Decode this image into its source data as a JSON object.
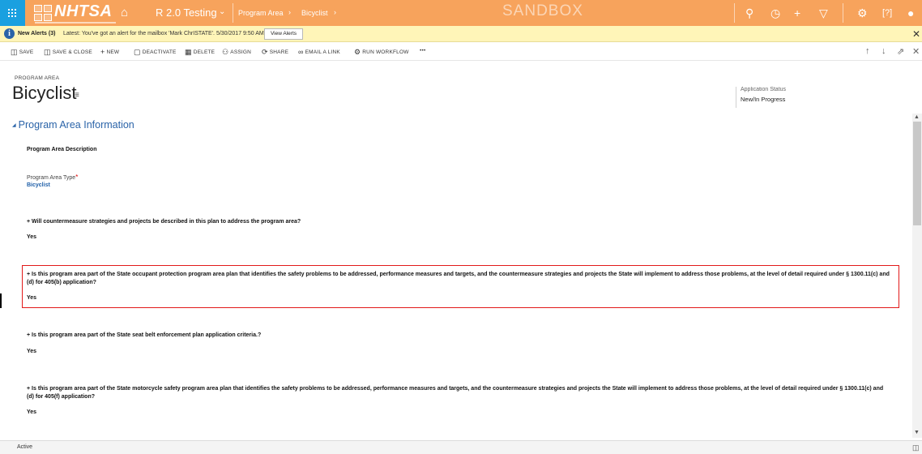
{
  "topbar": {
    "logo_text": "NHTSA",
    "app_name": "R 2.0 Testing",
    "breadcrumb": [
      "Program Area",
      "Bicyclist"
    ],
    "environment": "SANDBOX",
    "icons": [
      "waffle-icon",
      "home-icon",
      "search-icon",
      "history-icon",
      "add-icon",
      "filter-icon",
      "settings-icon",
      "help-icon",
      "user-icon"
    ]
  },
  "alert": {
    "title": "New Alerts (3)",
    "message": "Latest: You've got an alert for the mailbox 'Mark ChrISTATE'. 5/30/2017 9:50 AM",
    "button": "View Alerts"
  },
  "commands": [
    {
      "label": "SAVE",
      "icon": "save-icon"
    },
    {
      "label": "SAVE & CLOSE",
      "icon": "save-close-icon"
    },
    {
      "label": "NEW",
      "icon": "plus-icon"
    },
    {
      "label": "DEACTIVATE",
      "icon": "deactivate-icon"
    },
    {
      "label": "DELETE",
      "icon": "trash-icon"
    },
    {
      "label": "ASSIGN",
      "icon": "assign-icon"
    },
    {
      "label": "SHARE",
      "icon": "share-icon"
    },
    {
      "label": "EMAIL A LINK",
      "icon": "link-icon"
    },
    {
      "label": "RUN WORKFLOW",
      "icon": "workflow-icon"
    },
    {
      "label": "•••",
      "icon": "more-icon"
    }
  ],
  "record": {
    "entity_type": "PROGRAM AREA",
    "name": "Bicyclist",
    "status_label": "Application Status",
    "status_value": "New/In Progress"
  },
  "section": {
    "title": "Program Area Information",
    "fields": [
      {
        "label": "Program Area Description",
        "value": ""
      },
      {
        "label": "Program Area Type",
        "required": "*",
        "value": "Bicyclist"
      }
    ],
    "questions": [
      {
        "text": "+ Will countermeasure strategies and projects be described in this plan to address the program area?",
        "answer": "Yes"
      },
      {
        "text": "+ Is this program area part of the State occupant protection program area plan that identifies the safety problems to be addressed, performance measures and targets, and the countermeasure strategies and projects the State will implement to address those problems, at the level of detail required under § 1300.11(c) and (d) for 405(b) application?",
        "answer": "Yes"
      },
      {
        "text": "+ Is this program area part of the State seat belt enforcement plan application criteria.?",
        "answer": "Yes"
      },
      {
        "text": "+ Is this program area part of the State motorcycle safety program area plan that identifies the safety problems to be addressed, performance measures and targets, and the countermeasure strategies and projects the State will implement to address those problems, at the level of detail required under § 1300.11(c) and (d) for 405(f) application?",
        "answer": "Yes"
      }
    ]
  },
  "statusbar": {
    "status": "Active"
  },
  "colors": {
    "topbar": "#f7a35c",
    "waffle": "#1aa0e0",
    "accent": "#2a63a8",
    "highlight": "#e21a1a"
  }
}
